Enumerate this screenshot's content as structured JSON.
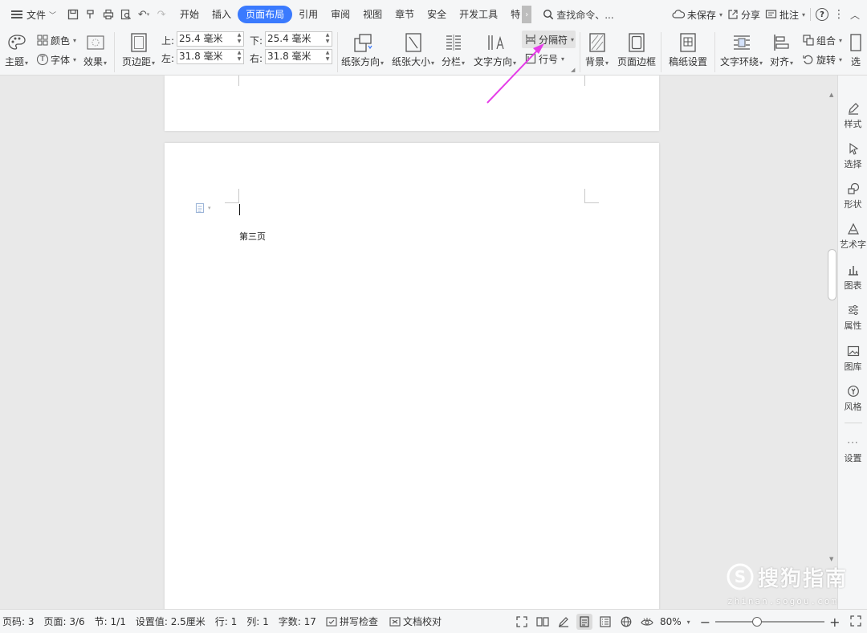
{
  "menubar": {
    "file_label": "文件",
    "tabs": [
      "开始",
      "插入",
      "页面布局",
      "引用",
      "审阅",
      "视图",
      "章节",
      "安全",
      "开发工具",
      "特"
    ],
    "active_tab": "页面布局",
    "search_label": "查找命令、...",
    "unsaved_label": "未保存",
    "share_label": "分享",
    "comment_label": "批注"
  },
  "ribbon": {
    "theme": "主题",
    "color": "颜色",
    "font": "字体",
    "effect": "效果",
    "margins": "页边距",
    "top_label": "上:",
    "top_value": "25.4 毫米",
    "bottom_label": "下:",
    "bottom_value": "25.4 毫米",
    "left_label": "左:",
    "left_value": "31.8 毫米",
    "right_label": "右:",
    "right_value": "31.8 毫米",
    "orientation": "纸张方向",
    "size": "纸张大小",
    "columns": "分栏",
    "text_direction": "文字方向",
    "breaks": "分隔符",
    "line_numbers": "行号",
    "background": "背景",
    "page_border": "页面边框",
    "manuscript": "稿纸设置",
    "wrap_text": "文字环绕",
    "align": "对齐",
    "group": "组合",
    "rotate": "旋转",
    "select": "选"
  },
  "document": {
    "page_text": "第三页"
  },
  "sidepanel": {
    "items": [
      "样式",
      "选择",
      "形状",
      "艺术字",
      "图表",
      "属性",
      "图库",
      "风格",
      "设置"
    ]
  },
  "statusbar": {
    "page_no": "页码: 3",
    "page_count": "页面: 3/6",
    "section": "节: 1/1",
    "setting": "设置值: 2.5厘米",
    "row": "行: 1",
    "col": "列: 1",
    "word_count": "字数: 17",
    "spell_check": "拼写检查",
    "proofread": "文档校对",
    "zoom": "80%",
    "zoom_level": 0.38
  },
  "watermark": {
    "cn": "搜狗指南",
    "en": "zhinan.sogou.com"
  },
  "colors": {
    "accent": "#3a7afe",
    "annotation_arrow": "#e53de8"
  }
}
